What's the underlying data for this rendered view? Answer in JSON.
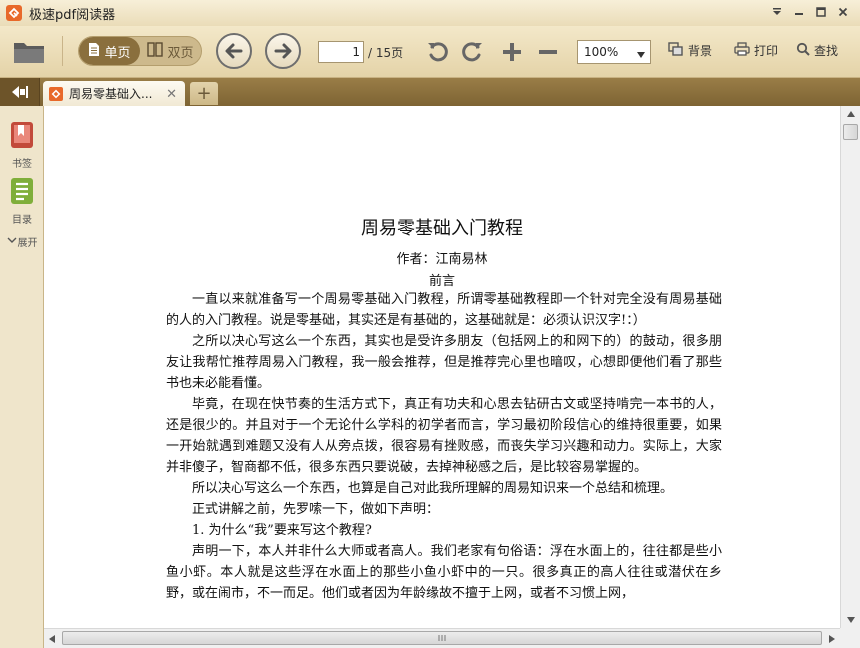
{
  "app": {
    "title": "极速pdf阅读器",
    "accent_color": "#e8692a"
  },
  "window_controls": [
    "menu-down-icon",
    "minimize-icon",
    "maximize-icon",
    "close-icon"
  ],
  "toolbar": {
    "single_page_label": "单页",
    "double_page_label": "双页",
    "current_page": "1",
    "total_pages": "/ 15页",
    "zoom": "100%",
    "background_label": "背景",
    "print_label": "打印",
    "find_label": "查找"
  },
  "tabs": [
    {
      "label": "周易零基础入...",
      "active": true
    }
  ],
  "left_panel": {
    "bookmark_label": "书签",
    "toc_label": "目录",
    "expand_label": "展开"
  },
  "document": {
    "title": "周易零基础入门教程",
    "author": "作者：江南易林",
    "preface": "前言",
    "paragraphs": [
      "一直以来就准备写一个周易零基础入门教程，所谓零基础教程即一个针对完全没有周易基础的人的入门教程。说是零基础，其实还是有基础的，这基础就是：必须认识汉字!：）",
      "之所以决心写这么一个东西，其实也是受许多朋友（包括网上的和网下的）的鼓动，很多朋友让我帮忙推荐周易入门教程，我一般会推荐，但是推荐完心里也暗叹，心想即便他们看了那些书也未必能看懂。",
      "毕竟，在现在快节奏的生活方式下，真正有功夫和心思去钻研古文或坚持啃完一本书的人，还是很少的。并且对于一个无论什么学科的初学者而言，学习最初阶段信心的维持很重要，如果一开始就遇到难题又没有人从旁点拨，很容易有挫败感，而丧失学习兴趣和动力。实际上，大家并非傻子，智商都不低，很多东西只要说破，去掉神秘感之后，是比较容易掌握的。",
      "所以决心写这么一个东西，也算是自己对此我所理解的周易知识来一个总结和梳理。",
      "正式讲解之前，先罗嗦一下，做如下声明：",
      "1.    为什么“我”要来写这个教程?",
      "声明一下，本人并非什么大师或者高人。我们老家有句俗语：浮在水面上的，往往都是些小鱼小虾。本人就是这些浮在水面上的那些小鱼小虾中的一只。很多真正的高人往往或潜伏在乡野，或在闹市，不一而足。他们或者因为年龄缘故不擅于上网，或者不习惯上网，"
    ]
  }
}
